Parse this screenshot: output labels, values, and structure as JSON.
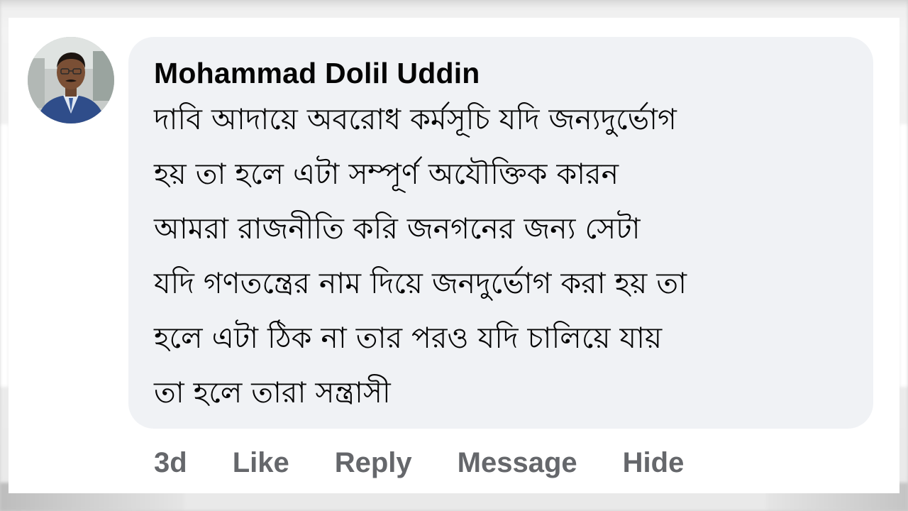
{
  "comment": {
    "author": "Mohammad Dolil Uddin",
    "text": "দাবি আদায়ে অবরোধ কর্মসূচি যদি জন্যদুর্ভোগ\nহয় তা হলে এটা সম্পূর্ণ অযৌক্তিক কারন\nআমরা রাজনীতি করি জনগনের জন্য সেটা\nযদি গণতন্ত্রের নাম দিয়ে জনদুর্ভোগ করা হয় তা\nহলে এটা ঠিক না তার পরও যদি চালিয়ে যায়\nতা হলে তারা সন্ত্রাসী",
    "time": "3d",
    "actions": {
      "like": "Like",
      "reply": "Reply",
      "message": "Message",
      "hide": "Hide"
    }
  },
  "colors": {
    "bubble_bg": "#f0f2f5",
    "text": "#050505",
    "secondary_text": "#65676b"
  },
  "icons": {
    "avatar": "profile-photo-man-in-suit"
  }
}
